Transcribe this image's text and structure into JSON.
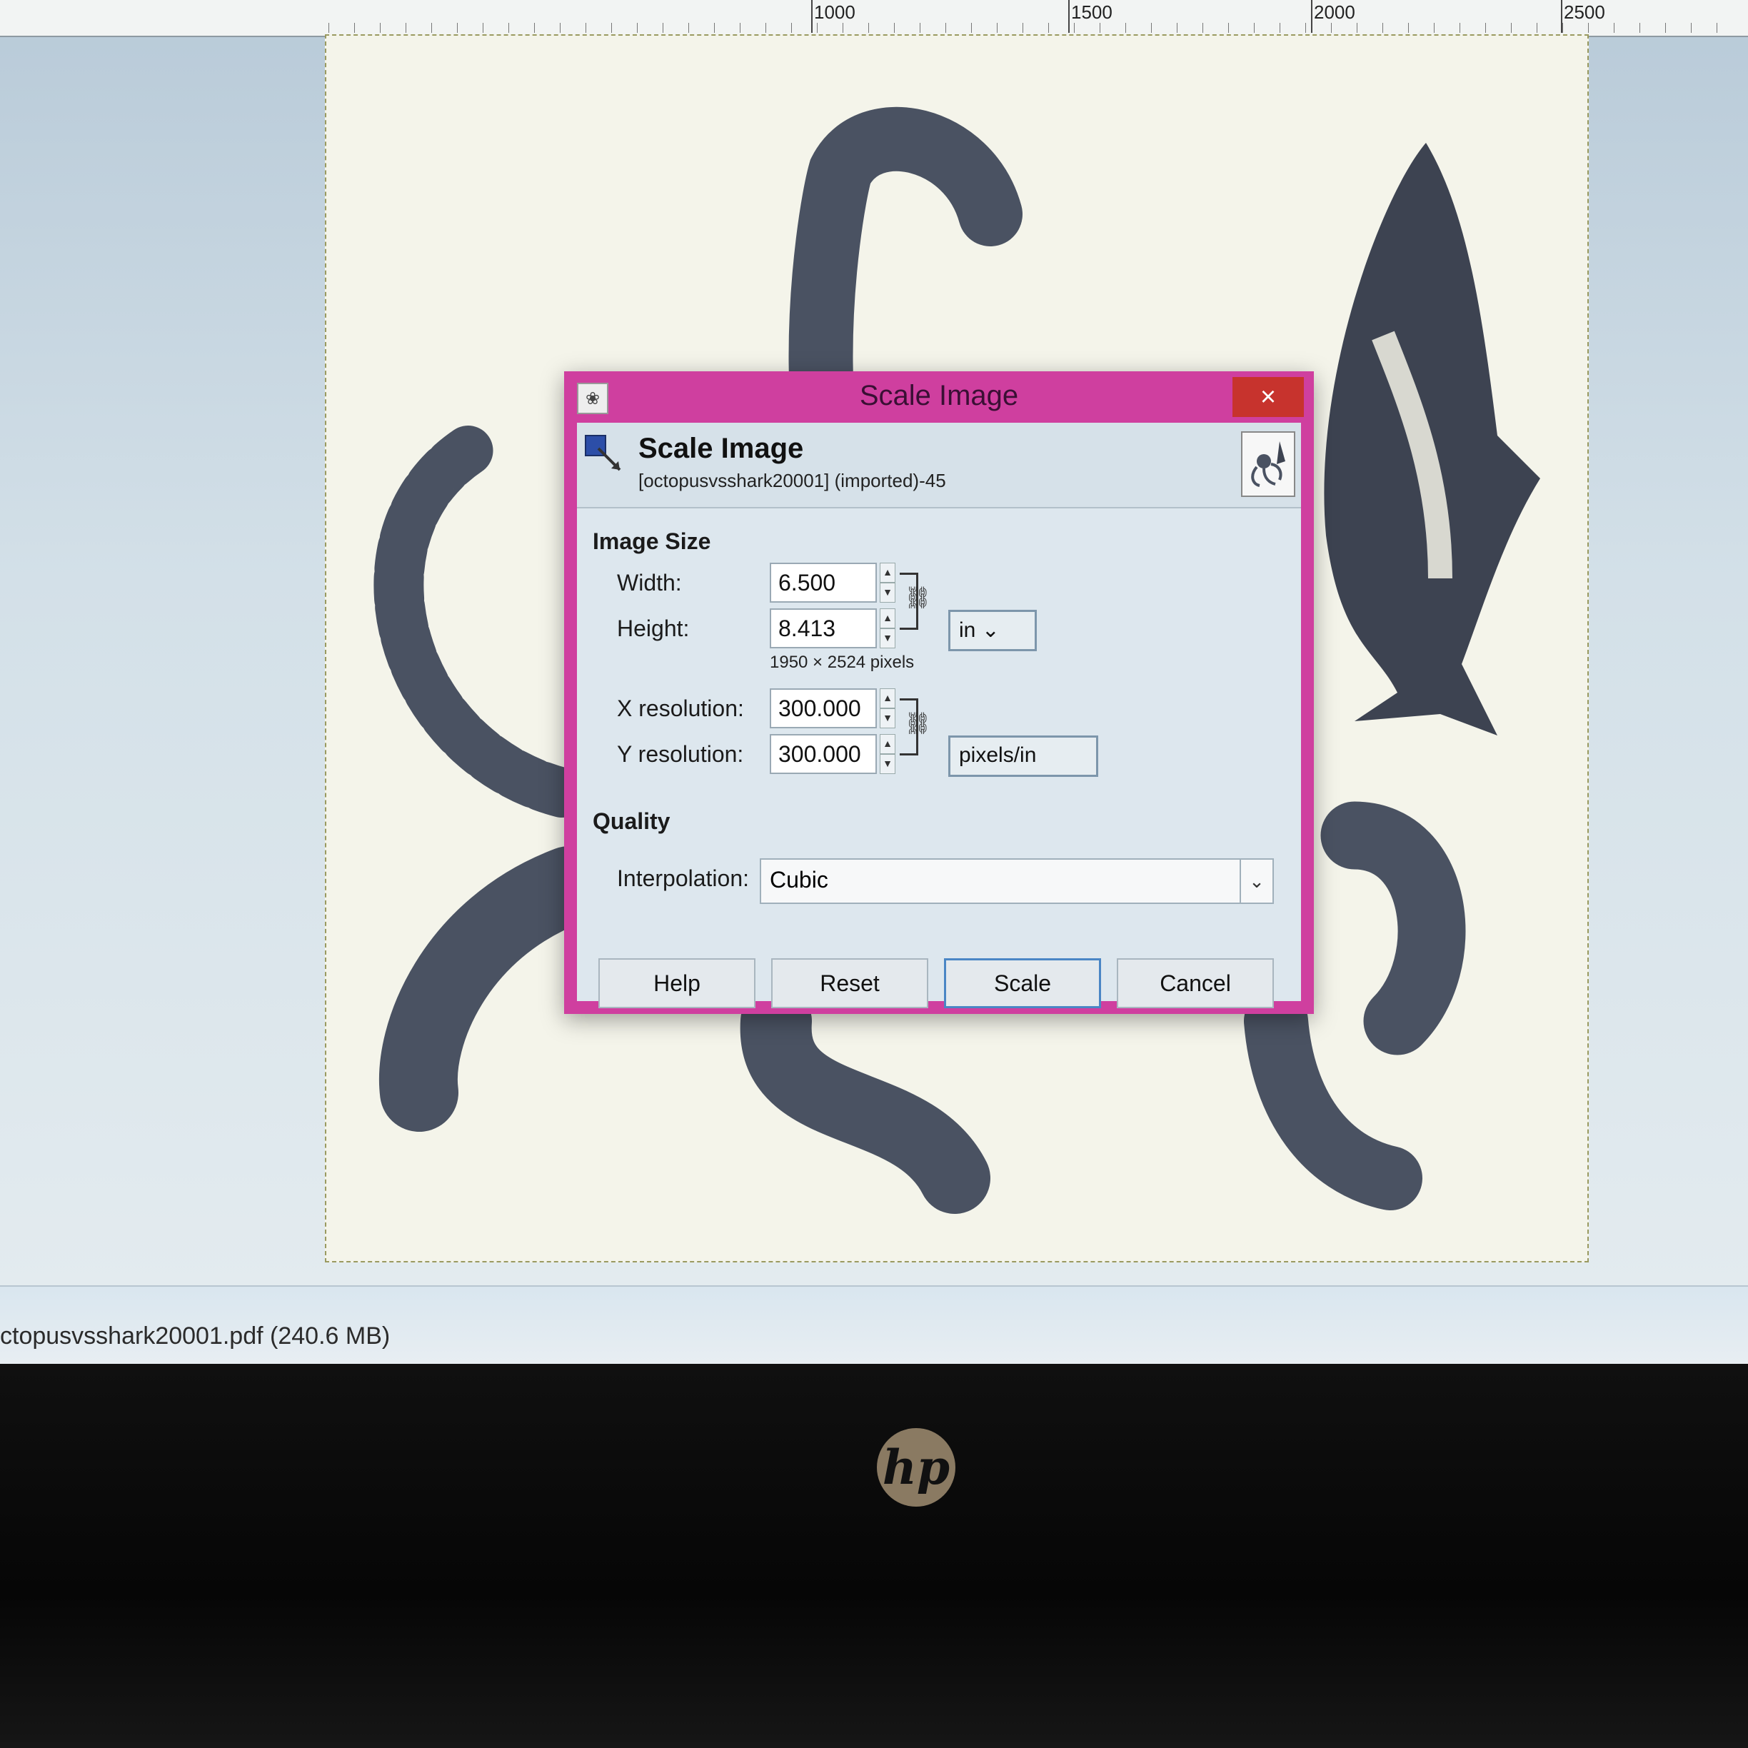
{
  "ruler": {
    "labels": [
      "1000",
      "1500",
      "2000",
      "2500"
    ]
  },
  "statusbar": {
    "file_info": "ctopusvsshark20001.pdf (240.6 MB)"
  },
  "dialog": {
    "window_title": "Scale Image",
    "close_label": "×",
    "header_title": "Scale Image",
    "header_subtitle": "[octopusvsshark20001] (imported)-45",
    "image_size_section": "Image Size",
    "width_label": "Width:",
    "width_value": "6.500",
    "height_label": "Height:",
    "height_value": "8.413",
    "size_unit": "in",
    "pixels_note": "1950 × 2524 pixels",
    "xres_label": "X resolution:",
    "xres_value": "300.000",
    "yres_label": "Y resolution:",
    "yres_value": "300.000",
    "res_unit": "pixels/in",
    "quality_section": "Quality",
    "interp_label": "Interpolation:",
    "interp_value": "Cubic",
    "buttons": {
      "help": "Help",
      "reset": "Reset",
      "scale": "Scale",
      "cancel": "Cancel"
    }
  },
  "colors": {
    "dialog_frame": "#cf3f9f",
    "close_button": "#c7332d",
    "dialog_body": "#dde7ee"
  },
  "icons": [
    "gimp-app-icon",
    "close-icon",
    "scale-tool-icon",
    "image-thumbnail",
    "spin-up-icon",
    "spin-down-icon",
    "chain-link-icon",
    "dropdown-arrow-icon",
    "mouse-cursor-icon",
    "hp-logo"
  ]
}
